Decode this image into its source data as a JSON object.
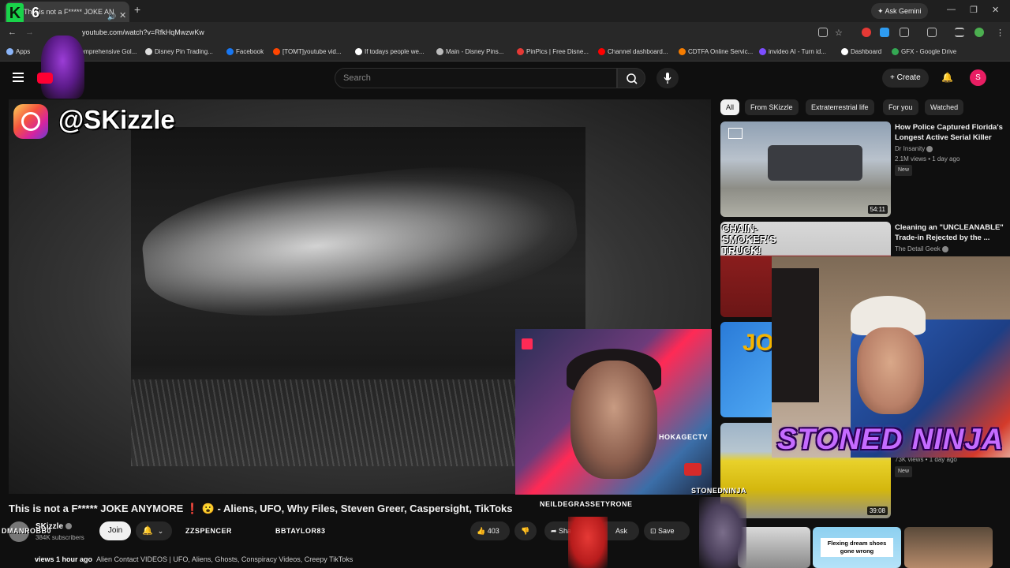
{
  "browser": {
    "tab_title": "This is not a F***** JOKE AN",
    "tab_number": "6",
    "url": "youtube.com/watch?v=RfkHqMwzwKw",
    "ask_gemini": "Ask Gemini",
    "bookmarks": [
      {
        "label": "Apps",
        "color": "#8ab4f8"
      },
      {
        "label": "Comprehensive Gol...",
        "color": "#999999"
      },
      {
        "label": "Disney Pin Trading...",
        "color": "#dddddd"
      },
      {
        "label": "Facebook",
        "color": "#1877f2"
      },
      {
        "label": "[TOMT]youtube vid...",
        "color": "#ff4500"
      },
      {
        "label": "If todays people we...",
        "color": "#ffffff"
      },
      {
        "label": "Main - Disney Pins...",
        "color": "#bbbbbb"
      },
      {
        "label": "PinPics | Free Disne...",
        "color": "#e53935"
      },
      {
        "label": "Channel dashboard...",
        "color": "#ff0000"
      },
      {
        "label": "CDTFA Online Servic...",
        "color": "#f57c00"
      },
      {
        "label": "invideo AI - Turn id...",
        "color": "#7c4dff"
      },
      {
        "label": "Dashboard",
        "color": "#ffffff"
      },
      {
        "label": "GFX - Google Drive",
        "color": "#34a853"
      }
    ]
  },
  "youtube": {
    "search_placeholder": "Search",
    "create_label": "Create",
    "avatar_letter": "S"
  },
  "player": {
    "instagram_handle": "@SKizzle"
  },
  "overlays": {
    "cam1_tag": "HOKAGECTV",
    "cam2_caption": "STONED NINJA",
    "names": [
      "NEILDEGRASSETYRONE",
      "STONEDNINJA",
      "ZZSPENCER",
      "BBTAYLOR83",
      "DMANROBB0"
    ]
  },
  "video": {
    "title": "This is not a F***** JOKE ANYMORE ❗ 😮 - Aliens, UFO, Why Files, Steven Greer, Caspersight, TikToks",
    "channel": "SKizzle",
    "subscribers": "384K subscribers",
    "join_label": "Join",
    "likes": "403",
    "share_label": "Share",
    "ask_label": "Ask",
    "save_label": "Save",
    "views_time": "views  1 hour ago",
    "description": "Alien Contact VIDEOS | UFO, Aliens, Ghosts, Conspiracy Videos, Creepy TikToks"
  },
  "sidebar": {
    "chips": [
      {
        "label": "All",
        "active": true
      },
      {
        "label": "From SKizzle",
        "active": false
      },
      {
        "label": "Extraterrestrial life",
        "active": false
      },
      {
        "label": "For you",
        "active": false
      },
      {
        "label": "Watched",
        "active": false
      }
    ],
    "recommendations": [
      {
        "title": "How Police Captured Florida's Longest Active Serial Killer",
        "channel": "Dr Insanity",
        "meta": "2.1M views • 1 day ago",
        "badge": "New",
        "duration": "54:11"
      },
      {
        "title": "Cleaning an \"UNCLEANABLE\" Trade-in Rejected by the ...",
        "channel": "The Detail Geek",
        "thumb_text": "CHAIN-SMOKER'S TRUCK!"
      },
      {
        "title": "",
        "thumb_text": "JO"
      },
      {
        "title": "",
        "meta": "73K views • 1 day ago",
        "badge": "New",
        "duration": "39:08"
      }
    ],
    "shorts_text": "Flexing dream shoes gone wrong"
  }
}
